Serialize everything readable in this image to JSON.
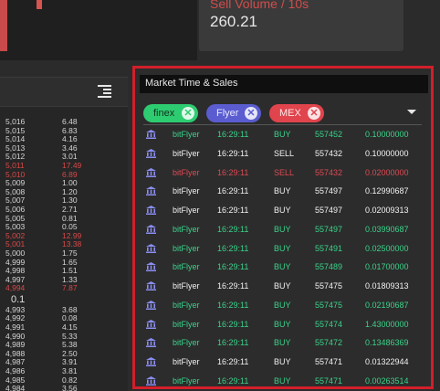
{
  "sell_volume": {
    "title": "Sell Volume / 10s",
    "value": "260.21"
  },
  "order_book": {
    "asks": [
      {
        "price": "5,016",
        "qty": "6.48",
        "red": false
      },
      {
        "price": "5,015",
        "qty": "6.83",
        "red": false
      },
      {
        "price": "5,014",
        "qty": "4.16",
        "red": false
      },
      {
        "price": "5,013",
        "qty": "3.46",
        "red": false
      },
      {
        "price": "5,012",
        "qty": "3.01",
        "red": false
      },
      {
        "price": "5,011",
        "qty": "17.49",
        "red": true
      },
      {
        "price": "5,010",
        "qty": "6.89",
        "red": true
      },
      {
        "price": "5,009",
        "qty": "1.00",
        "red": false
      },
      {
        "price": "5,008",
        "qty": "1.20",
        "red": false
      },
      {
        "price": "5,007",
        "qty": "1.30",
        "red": false
      },
      {
        "price": "5,006",
        "qty": "2.71",
        "red": false
      },
      {
        "price": "5,005",
        "qty": "0.81",
        "red": false
      },
      {
        "price": "5,003",
        "qty": "0.05",
        "red": false
      },
      {
        "price": "5,002",
        "qty": "12.99",
        "red": true
      },
      {
        "price": "5,001",
        "qty": "13.38",
        "red": true
      },
      {
        "price": "5,000",
        "qty": "1.75",
        "red": false
      },
      {
        "price": "4,999",
        "qty": "1.65",
        "red": false
      },
      {
        "price": "4,998",
        "qty": "1.51",
        "red": false
      },
      {
        "price": "4,997",
        "qty": "1.33",
        "red": false
      },
      {
        "price": "4,994",
        "qty": "7.87",
        "red": true
      }
    ],
    "spread": "0.1",
    "bids": [
      {
        "price": "4,993",
        "qty": "3.68",
        "red": false
      },
      {
        "price": "4,992",
        "qty": "0.08",
        "red": false
      },
      {
        "price": "4,991",
        "qty": "4.15",
        "red": false
      },
      {
        "price": "4,990",
        "qty": "5.33",
        "red": false
      },
      {
        "price": "4,989",
        "qty": "5.38",
        "red": false
      },
      {
        "price": "4,988",
        "qty": "2.50",
        "red": false
      },
      {
        "price": "4,987",
        "qty": "3.91",
        "red": false
      },
      {
        "price": "4,986",
        "qty": "3.81",
        "red": false
      },
      {
        "price": "4,985",
        "qty": "0.82",
        "red": false
      },
      {
        "price": "4,984",
        "qty": "3.56",
        "red": false
      }
    ]
  },
  "market_time_sales": {
    "title": "Market Time & Sales",
    "filters": [
      {
        "label": "finex",
        "color": "#2ecc71"
      },
      {
        "label": "Flyer",
        "color": "#5a5cd0"
      },
      {
        "label": "MEX",
        "color": "#e0444c"
      }
    ],
    "trades": [
      {
        "exchange": "bitFlyer",
        "time": "16:29:11",
        "side": "BUY",
        "id": "557452",
        "amount": "0.10000000",
        "tone": "green"
      },
      {
        "exchange": "bitFlyer",
        "time": "16:29:11",
        "side": "SELL",
        "id": "557432",
        "amount": "0.10000000",
        "tone": "white"
      },
      {
        "exchange": "bitFlyer",
        "time": "16:29:11",
        "side": "SELL",
        "id": "557432",
        "amount": "0.02000000",
        "tone": "red"
      },
      {
        "exchange": "bitFlyer",
        "time": "16:29:11",
        "side": "BUY",
        "id": "557497",
        "amount": "0.12990687",
        "tone": "white"
      },
      {
        "exchange": "bitFlyer",
        "time": "16:29:11",
        "side": "BUY",
        "id": "557497",
        "amount": "0.02009313",
        "tone": "white"
      },
      {
        "exchange": "bitFlyer",
        "time": "16:29:11",
        "side": "BUY",
        "id": "557497",
        "amount": "0.03990687",
        "tone": "green"
      },
      {
        "exchange": "bitFlyer",
        "time": "16:29:11",
        "side": "BUY",
        "id": "557491",
        "amount": "0.02500000",
        "tone": "green"
      },
      {
        "exchange": "bitFlyer",
        "time": "16:29:11",
        "side": "BUY",
        "id": "557489",
        "amount": "0.01700000",
        "tone": "green"
      },
      {
        "exchange": "bitFlyer",
        "time": "16:29:11",
        "side": "BUY",
        "id": "557475",
        "amount": "0.01809313",
        "tone": "white"
      },
      {
        "exchange": "bitFlyer",
        "time": "16:29:11",
        "side": "BUY",
        "id": "557475",
        "amount": "0.02190687",
        "tone": "green"
      },
      {
        "exchange": "bitFlyer",
        "time": "16:29:11",
        "side": "BUY",
        "id": "557474",
        "amount": "1.43000000",
        "tone": "green"
      },
      {
        "exchange": "bitFlyer",
        "time": "16:29:11",
        "side": "BUY",
        "id": "557472",
        "amount": "0.13486369",
        "tone": "green"
      },
      {
        "exchange": "bitFlyer",
        "time": "16:29:11",
        "side": "BUY",
        "id": "557471",
        "amount": "0.01322944",
        "tone": "white"
      },
      {
        "exchange": "bitFlyer",
        "time": "16:29:11",
        "side": "BUY",
        "id": "557471",
        "amount": "0.00263514",
        "tone": "green"
      }
    ]
  },
  "colors": {
    "accent_border": "#d21f2a",
    "buy": "#3ad38a",
    "sell": "#dd4a52"
  }
}
